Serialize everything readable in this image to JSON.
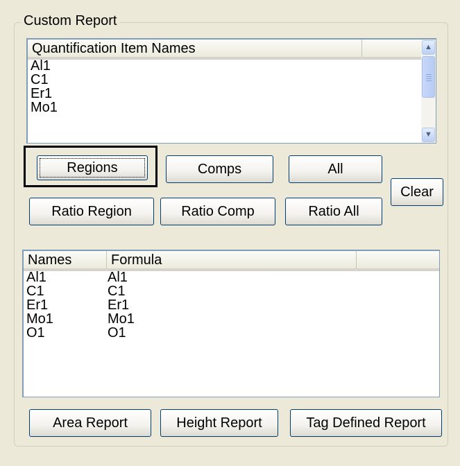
{
  "group": {
    "title": "Custom Report"
  },
  "items_list": {
    "columns": [
      "Quantification Item Names",
      ""
    ],
    "rows": [
      "Al1",
      "C1",
      "Er1",
      "Mo1"
    ]
  },
  "buttons": {
    "regions": "Regions",
    "comps": "Comps",
    "all": "All",
    "clear": "Clear",
    "ratio_region": "Ratio Region",
    "ratio_comp": "Ratio Comp",
    "ratio_all": "Ratio All",
    "area_report": "Area Report",
    "height_report": "Height Report",
    "tag_defined_report": "Tag Defined Report"
  },
  "formula_list": {
    "columns": [
      "Names",
      "Formula",
      ""
    ],
    "rows": [
      {
        "name": "Al1",
        "formula": "Al1"
      },
      {
        "name": "C1",
        "formula": "C1"
      },
      {
        "name": "Er1",
        "formula": "Er1"
      },
      {
        "name": "Mo1",
        "formula": "Mo1"
      },
      {
        "name": "O1",
        "formula": "O1"
      }
    ]
  }
}
